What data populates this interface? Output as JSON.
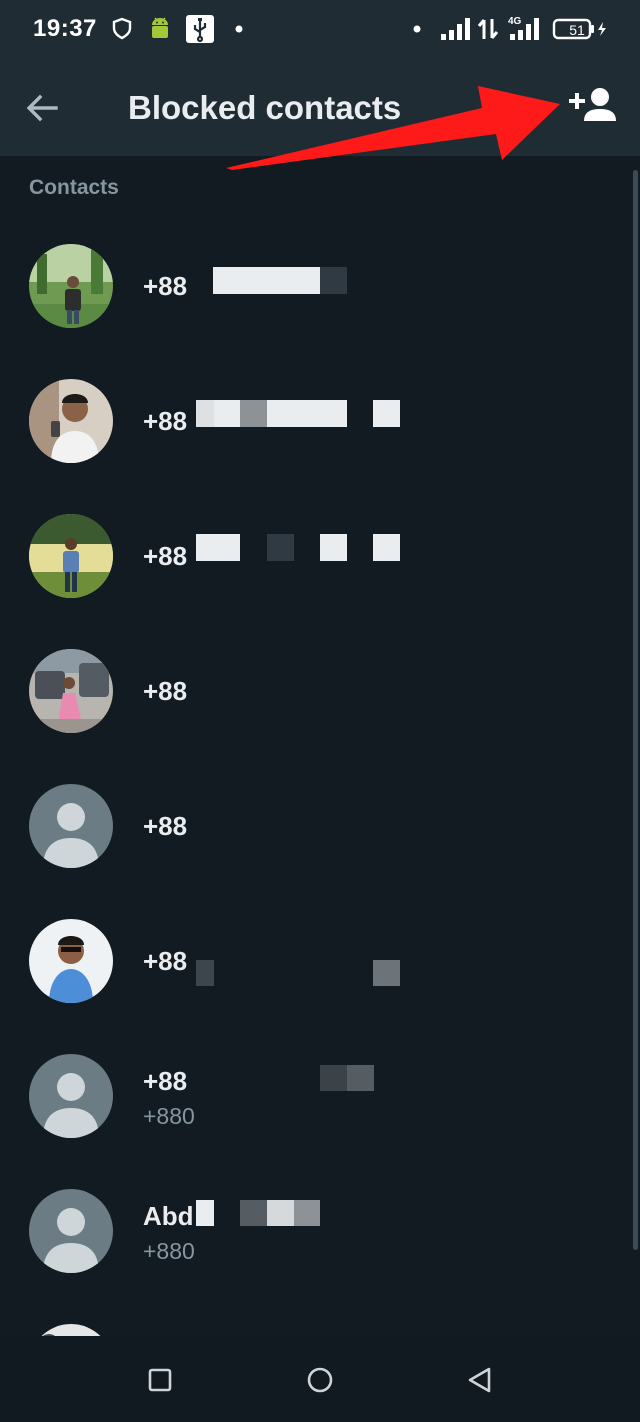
{
  "status_bar": {
    "time": "19:37",
    "battery": "51",
    "network": "4G",
    "icons": [
      "shield-icon",
      "android-icon",
      "usb-icon",
      "dot-icon",
      "dot-icon",
      "signal-icon",
      "data-arrows-icon",
      "signal-4g-icon",
      "battery-icon",
      "charging-icon"
    ]
  },
  "app_bar": {
    "title": "Blocked contacts",
    "back_icon": "back-arrow-icon",
    "add_icon": "add-person-icon"
  },
  "section": {
    "header": "Contacts"
  },
  "contacts": [
    {
      "name": "+88",
      "sub": "",
      "avatar": "photo"
    },
    {
      "name": "+88",
      "sub": "",
      "avatar": "photo"
    },
    {
      "name": "+88",
      "sub": "",
      "avatar": "photo"
    },
    {
      "name": "+88",
      "sub": "",
      "avatar": "photo"
    },
    {
      "name": "+88",
      "sub": "",
      "avatar": "default"
    },
    {
      "name": "+88",
      "sub": "",
      "avatar": "photo"
    },
    {
      "name": "+88",
      "sub": "+880",
      "avatar": "default"
    },
    {
      "name": "Abd",
      "sub": "+880",
      "avatar": "default"
    }
  ],
  "nav_bar": {
    "icons": [
      "recents-square-icon",
      "home-circle-icon",
      "back-triangle-icon"
    ]
  },
  "colors": {
    "background": "#121b22",
    "app_bar": "#1f2c34",
    "primary_text": "#e9edef",
    "secondary_text": "#8696a0",
    "annotation": "#ff1a1a"
  }
}
